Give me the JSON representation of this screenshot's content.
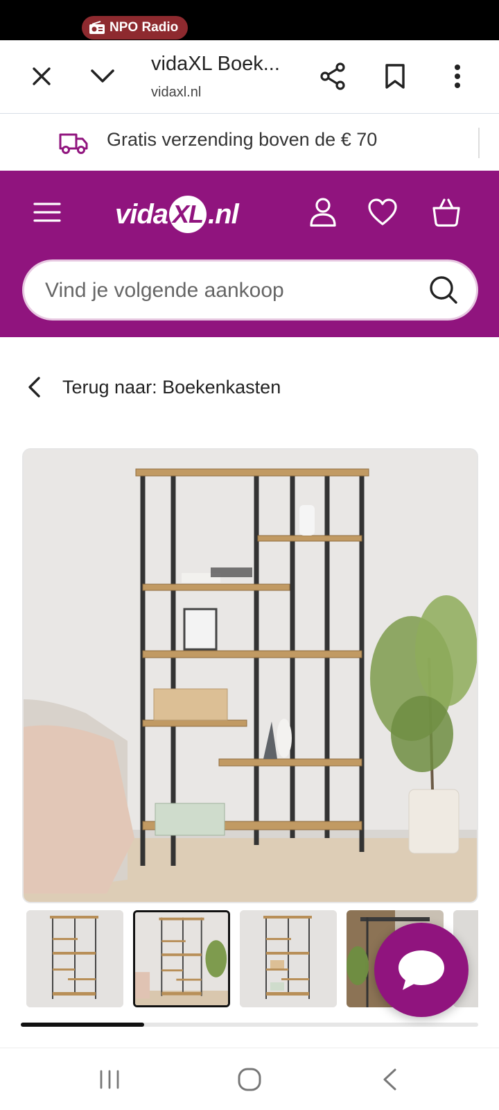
{
  "status_bar": {
    "radio_label": "NPO Radio"
  },
  "browser": {
    "title": "vidaXL Boek...",
    "url": "vidaxl.nl",
    "close_icon": "close-icon",
    "collapse_icon": "chevron-down-icon",
    "share_icon": "share-icon",
    "bookmark_icon": "bookmark-icon",
    "menu_icon": "more-vert-icon"
  },
  "promo": {
    "text": "Gratis verzending boven de € 70",
    "icon": "truck-icon"
  },
  "header": {
    "brand_color": "#90147e",
    "logo_prefix": "vida",
    "logo_mark": "XL",
    "logo_suffix": ".nl",
    "menu_icon": "hamburger-icon",
    "account_icon": "user-icon",
    "wishlist_icon": "heart-icon",
    "cart_icon": "basket-icon"
  },
  "search": {
    "placeholder": "Vind je volgende aankoop",
    "icon": "search-icon"
  },
  "breadcrumb": {
    "back_text": "Terug naar: Boekenkasten",
    "icon": "chevron-left-icon"
  },
  "gallery": {
    "main_image": "bookcase-product-photo",
    "thumbnails": [
      "thumb-1",
      "thumb-2",
      "thumb-3",
      "thumb-4",
      "thumb-5"
    ],
    "active_index": 1,
    "scroll_progress": 0.27
  },
  "chat": {
    "icon": "chat-bubble-icon"
  },
  "system_nav": {
    "recents_icon": "recents-icon",
    "home_icon": "home-icon",
    "back_icon": "back-icon"
  }
}
